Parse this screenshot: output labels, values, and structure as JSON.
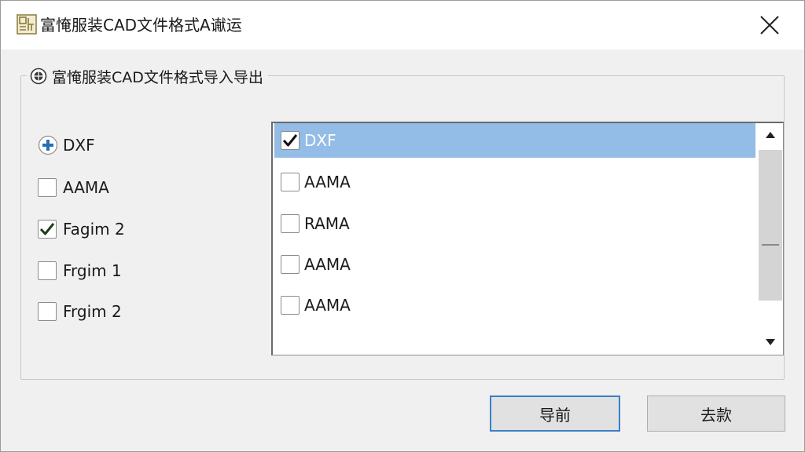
{
  "window": {
    "title": "富㤿服装CAD文件格式A谳运",
    "icon": "app-logo-icon"
  },
  "group": {
    "legend": "富㤿服装CAD文件格式导入导出",
    "legend_icon": "disc-icon"
  },
  "left_options": [
    {
      "label": "DXF",
      "type": "expand",
      "checked": false
    },
    {
      "label": "AAMA",
      "type": "checkbox",
      "checked": false
    },
    {
      "label": "Fagim 2",
      "type": "checkbox",
      "checked": true
    },
    {
      "label": "Frgim 1",
      "type": "checkbox",
      "checked": false
    },
    {
      "label": "Frgim 2",
      "type": "checkbox",
      "checked": false
    }
  ],
  "list_items": [
    {
      "label": "DXF",
      "checked": true,
      "selected": true
    },
    {
      "label": "AAMA",
      "checked": false,
      "selected": false
    },
    {
      "label": "RAMA",
      "checked": false,
      "selected": false
    },
    {
      "label": "AAMA",
      "checked": false,
      "selected": false
    },
    {
      "label": "AAMA",
      "checked": false,
      "selected": false
    }
  ],
  "buttons": {
    "primary_label": "导前",
    "secondary_label": "去款"
  },
  "colors": {
    "selection": "#93bce6",
    "accent_border": "#3c7fc8",
    "dialog_bg": "#f0f0f0",
    "plus_icon": "#2a6db5"
  }
}
